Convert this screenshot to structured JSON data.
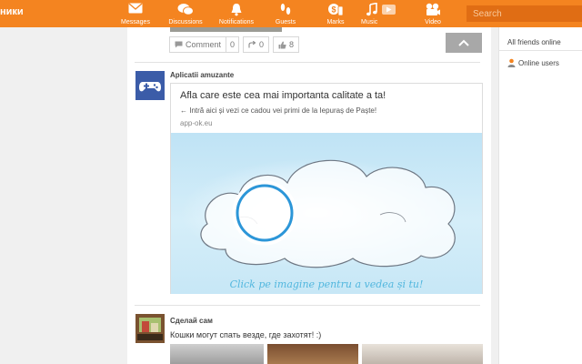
{
  "header": {
    "logo": "ники",
    "nav": [
      {
        "label": "Messages",
        "icon": "envelope-icon"
      },
      {
        "label": "Discussions",
        "icon": "chat-bubbles-icon"
      },
      {
        "label": "Notifications",
        "icon": "bell-icon"
      },
      {
        "label": "Guests",
        "icon": "footprints-icon"
      },
      {
        "label": "Marks",
        "icon": "marks-icon"
      },
      {
        "label": "Music",
        "icon": "music-note-icon"
      },
      {
        "label": "Video",
        "icon": "video-camera-icon"
      }
    ],
    "search_placeholder": "Search"
  },
  "feed": {
    "prev_post": {
      "comment_label": "Comment",
      "comment_count": "0",
      "share_count": "0",
      "like_count": "8"
    },
    "post_app": {
      "author": "Aplicatii amuzante",
      "card_title": "Afla care este cea mai importanta calitate a ta!",
      "card_subtitle": "← Intră aici și vezi ce cadou vei primi de la Iepuraș de Paște!",
      "card_host": "app-ok.eu",
      "image_caption": "Click pe imagine pentru a vedea și tu!"
    },
    "post_diy": {
      "author": "Сделай сам",
      "text": "Кошки могут спать везде, где захотят! :)"
    }
  },
  "sidebar": {
    "all_friends": "All friends online",
    "online_users": "Online users"
  },
  "colors": {
    "brand_orange": "#f48420",
    "search_bg": "#e06d14",
    "caption_blue": "#52b7de"
  }
}
